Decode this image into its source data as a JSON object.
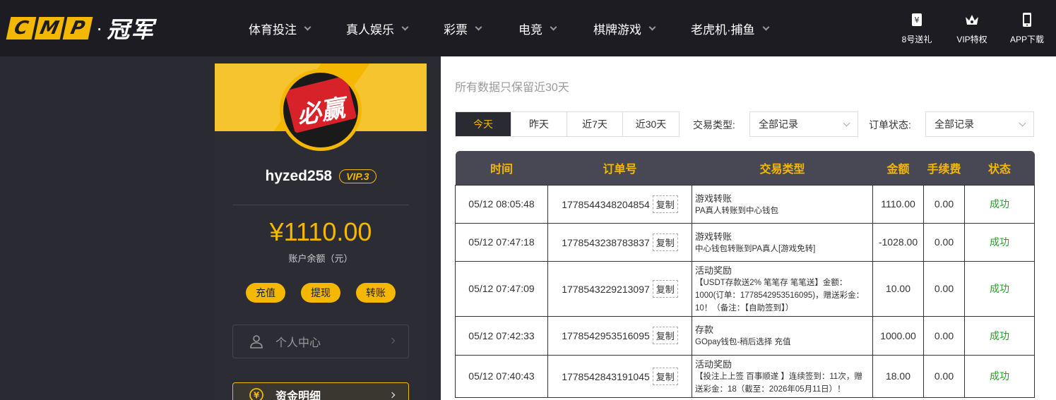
{
  "brand": {
    "cmp_letters": [
      "C",
      "M",
      "P"
    ],
    "dot": "·",
    "cn_name": "冠军"
  },
  "nav": [
    {
      "label": "体育投注"
    },
    {
      "label": "真人娱乐"
    },
    {
      "label": "彩票"
    },
    {
      "label": "电竞"
    },
    {
      "label": "棋牌游戏"
    },
    {
      "label": "老虎机·捕鱼"
    }
  ],
  "right_icons": [
    {
      "label": "8号送礼",
      "icon": "gift-money-icon"
    },
    {
      "label": "VIP特权",
      "icon": "crown-icon"
    },
    {
      "label": "APP下载",
      "icon": "phone-icon"
    }
  ],
  "sidebar": {
    "avatar_text": "必赢",
    "username": "hyzed258",
    "vip": "VIP.3",
    "balance": "¥1110.00",
    "balance_label": "账户余额（元）",
    "actions": [
      "充值",
      "提现",
      "转账"
    ],
    "menu": [
      {
        "label": "个人中心",
        "icon": "user-icon"
      },
      {
        "label": "资金明细",
        "icon": "yen-coin-icon"
      }
    ]
  },
  "main": {
    "subtitle": "所有数据只保留近30天",
    "tabs": [
      "今天",
      "昨天",
      "近7天",
      "近30天"
    ],
    "active_tab": 0,
    "filters": [
      {
        "label": "交易类型:",
        "value": "全部记录"
      },
      {
        "label": "订单状态:",
        "value": "全部记录"
      }
    ],
    "table": {
      "headers": [
        "时间",
        "订单号",
        "交易类型",
        "金额",
        "手续费",
        "状态"
      ],
      "copy_label": "复制",
      "rows": [
        {
          "time": "05/12 08:05:48",
          "order": "1778544348204854",
          "type": "游戏转账",
          "type_detail": "PA真人转账到中心钱包",
          "amount": "1110.00",
          "fee": "0.00",
          "status": "成功"
        },
        {
          "time": "05/12 07:47:18",
          "order": "1778543238783837",
          "type": "游戏转账",
          "type_detail": "中心钱包转账到PA真人[游戏免转]",
          "amount": "-1028.00",
          "fee": "0.00",
          "status": "成功"
        },
        {
          "time": "05/12 07:47:09",
          "order": "1778543229213097",
          "type": "活动奖励",
          "type_detail": "【USDT存款送2% 笔笔存 笔笔送】金额：1000(订单：1778542953516095)，赠送彩金：10！（备注：【自助签到】）",
          "amount": "10.00",
          "fee": "0.00",
          "status": "成功"
        },
        {
          "time": "05/12 07:42:33",
          "order": "1778542953516095",
          "type": "存款",
          "type_detail": "GOpay钱包-稍后选择 充值",
          "amount": "1000.00",
          "fee": "0.00",
          "status": "成功"
        },
        {
          "time": "05/12 07:40:43",
          "order": "1778542843191045",
          "type": "活动奖励",
          "type_detail": "【投注上上签 百事顺遂 】连续签到：11次，赠送彩金：18（截至：2026年05月11日）！",
          "amount": "18.00",
          "fee": "0.00",
          "status": "成功"
        }
      ]
    }
  },
  "colors": {
    "accent": "#f5b800",
    "header_bg": "#1c1c22",
    "sidebar_bg": "#2c2c34",
    "table_head": "#484854",
    "success": "#2a9a2a"
  }
}
